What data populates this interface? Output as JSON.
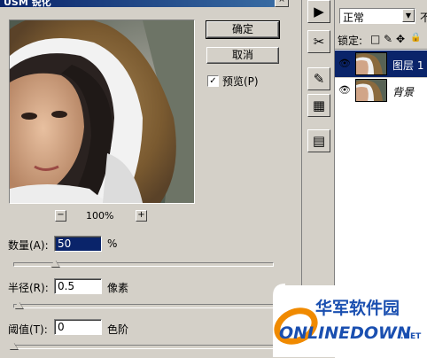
{
  "dialog": {
    "title": "USM 锐化",
    "close_label": "×",
    "ok_label": "确定",
    "cancel_label": "取消",
    "preview_check_mark": "✓",
    "preview_label": "预览(P)",
    "preview_checked": true,
    "zoom_out_label": "−",
    "zoom_in_label": "+",
    "zoom_level": "100%",
    "amount": {
      "label": "数量(A):",
      "value": "50",
      "unit": "%",
      "slider_fraction": 0.16
    },
    "radius": {
      "label": "半径(R):",
      "value": "0.5",
      "unit": "像素",
      "slider_fraction": 0.02
    },
    "threshold": {
      "label": "阈值(T):",
      "value": "0",
      "unit": "色阶",
      "slider_fraction": 0.0
    }
  },
  "tools": {
    "items": [
      {
        "icon": "play-icon",
        "glyph": "▶"
      },
      {
        "icon": "scissors-tools-icon",
        "glyph": "✂"
      },
      {
        "icon": "brush-stamp-icon",
        "glyph": "✎"
      },
      {
        "icon": "channels-icon",
        "glyph": "▦"
      },
      {
        "icon": "document-panel-icon",
        "glyph": "▤"
      }
    ]
  },
  "layers": {
    "blend_mode": "正常",
    "blend_arrow": "▼",
    "opacity_label": "不",
    "lock_label": "锁定:",
    "lock_icons": [
      "□",
      "✎",
      "✥",
      "🔒"
    ],
    "eye_glyph": "👁",
    "items": [
      {
        "name": "图层 1",
        "selected": true
      },
      {
        "name": "背景",
        "selected": false
      }
    ]
  },
  "watermark": {
    "text_cn": "华军软件园",
    "text_en": "ONLINEDOWN",
    "suffix": ".NET"
  },
  "colors": {
    "dialog_bg": "#d4d0c8",
    "titlebar": "#0a246a",
    "selected_layer": "#0a246a",
    "watermark_blue": "#1a4fb0",
    "watermark_orange": "#f08a00"
  }
}
